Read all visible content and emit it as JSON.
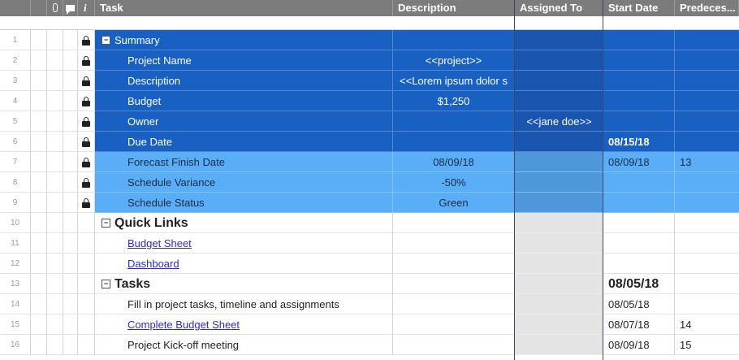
{
  "header": {
    "info_label": "i",
    "task": "Task",
    "description": "Description",
    "assigned_to": "Assigned To",
    "start_date": "Start Date",
    "predecessors": "Predeces..."
  },
  "rows": [
    {
      "num": "1",
      "task": "Summary",
      "desc": "",
      "assigned": "",
      "start": "",
      "pred": ""
    },
    {
      "num": "2",
      "task": "Project Name",
      "desc": "<<project>>",
      "assigned": "",
      "start": "",
      "pred": ""
    },
    {
      "num": "3",
      "task": "Description",
      "desc": "<<Lorem ipsum dolor s",
      "assigned": "",
      "start": "",
      "pred": ""
    },
    {
      "num": "4",
      "task": "Budget",
      "desc": "$1,250",
      "assigned": "",
      "start": "",
      "pred": ""
    },
    {
      "num": "5",
      "task": "Owner",
      "desc": "",
      "assigned": "<<jane doe>>",
      "start": "",
      "pred": ""
    },
    {
      "num": "6",
      "task": "Due Date",
      "desc": "",
      "assigned": "",
      "start": "08/15/18",
      "pred": ""
    },
    {
      "num": "7",
      "task": "Forecast Finish Date",
      "desc": "08/09/18",
      "assigned": "",
      "start": "08/09/18",
      "pred": "13"
    },
    {
      "num": "8",
      "task": "Schedule Variance",
      "desc": "-50%",
      "assigned": "",
      "start": "",
      "pred": ""
    },
    {
      "num": "9",
      "task": "Schedule Status",
      "desc": "Green",
      "assigned": "",
      "start": "",
      "pred": ""
    },
    {
      "num": "10",
      "task": "Quick Links",
      "desc": "",
      "assigned": "",
      "start": "",
      "pred": ""
    },
    {
      "num": "11",
      "task": "Budget Sheet",
      "desc": "",
      "assigned": "",
      "start": "",
      "pred": ""
    },
    {
      "num": "12",
      "task": "Dashboard",
      "desc": "",
      "assigned": "",
      "start": "",
      "pred": ""
    },
    {
      "num": "13",
      "task": "Tasks",
      "desc": "",
      "assigned": "",
      "start": "08/05/18",
      "pred": ""
    },
    {
      "num": "14",
      "task": "Fill in project tasks, timeline and assignments",
      "desc": "",
      "assigned": "",
      "start": "08/05/18",
      "pred": ""
    },
    {
      "num": "15",
      "task": "Complete Budget Sheet",
      "desc": "",
      "assigned": "",
      "start": "08/07/18",
      "pred": "14"
    },
    {
      "num": "16",
      "task": "Project Kick-off meeting",
      "desc": "",
      "assigned": "",
      "start": "08/09/18",
      "pred": "15"
    }
  ],
  "colors": {
    "summary_blue": "#1860c2",
    "metrics_light_blue": "#5aaef7",
    "header_gray": "#7c7c7c",
    "link": "#2a2ad8"
  }
}
